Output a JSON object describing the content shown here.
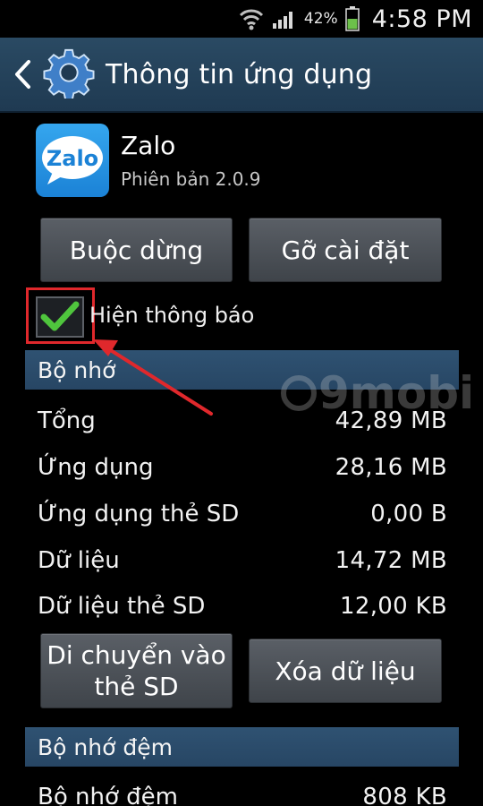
{
  "status_bar": {
    "battery_percent": "42%",
    "time": "4:58 PM",
    "icons": [
      "wifi-icon",
      "signal-icon",
      "battery-icon"
    ]
  },
  "action_bar": {
    "title": "Thông tin ứng dụng",
    "icons": [
      "back-arrow-icon",
      "settings-gear-icon"
    ]
  },
  "app": {
    "name": "Zalo",
    "version": "Phiên bản 2.0.9",
    "logo_text": "Zalo"
  },
  "buttons": {
    "force_stop": "Buộc dừng",
    "uninstall": "Gỡ cài đặt",
    "move_line1": "Di chuyển vào",
    "move_line2": "thẻ SD",
    "clear_data": "Xóa dữ liệu"
  },
  "notifications": {
    "label": "Hiện thông báo",
    "checked": true
  },
  "storage": {
    "header": "Bộ nhớ",
    "rows": [
      {
        "label": "Tổng",
        "value": "42,89 MB"
      },
      {
        "label": "Ứng dụng",
        "value": "28,16 MB"
      },
      {
        "label": "Ứng dụng thẻ SD",
        "value": "0,00 B"
      },
      {
        "label": "Dữ liệu",
        "value": "14,72 MB"
      },
      {
        "label": "Dữ liệu thẻ SD",
        "value": "12,00 KB"
      }
    ]
  },
  "cache": {
    "header": "Bộ nhớ đệm",
    "rows": [
      {
        "label": "Bộ nhớ đệm",
        "value": "808 KB"
      }
    ]
  },
  "watermark": {
    "text": "9mobi"
  },
  "colors": {
    "action_bar": "#1f3a52",
    "section_header": "#2a4b6a",
    "highlight": "#e0282c",
    "check": "#4fc53d",
    "logo_blue": "#2196e8"
  }
}
